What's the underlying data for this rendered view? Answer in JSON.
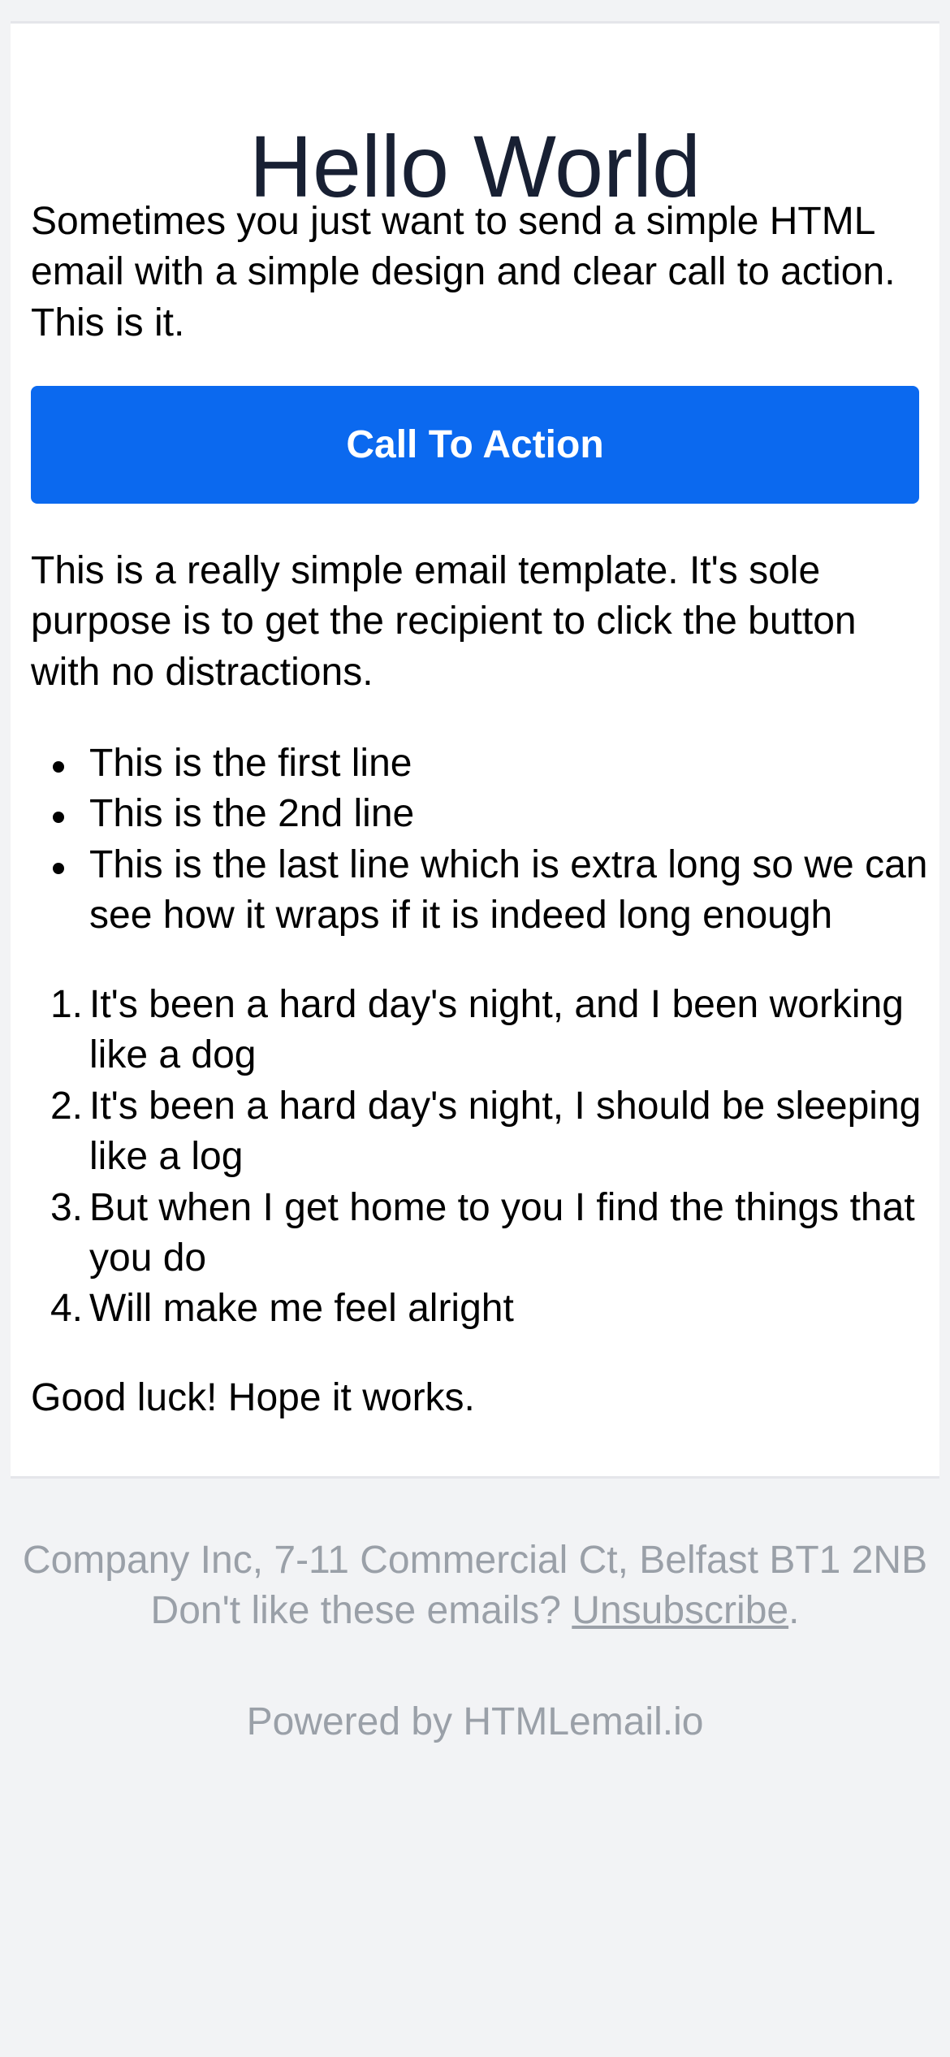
{
  "email": {
    "title": "Hello World",
    "intro": "Sometimes you just want to send a simple HTML email with a simple design and clear call to action. This is it.",
    "cta_label": "Call To Action",
    "body": "This is a really simple email template. It's sole purpose is to get the recipient to click the button with no distractions.",
    "bullets": [
      "This is the first line",
      "This is the 2nd line",
      "This is the last line which is extra long so we can see how it wraps if it is indeed long enough"
    ],
    "numbered": [
      {
        "marker": "1.",
        "text": "It's been a hard day's night, and I been working like a dog"
      },
      {
        "marker": "2.",
        "text": "It's been a hard day's night, I should be sleeping like a log"
      },
      {
        "marker": "3.",
        "text": "But when I get home to you I find the things that you do"
      },
      {
        "marker": "4.",
        "text": "Will make me feel alright"
      }
    ],
    "closing": "Good luck! Hope it works."
  },
  "footer": {
    "address": "Company Inc, 7-11 Commercial Ct, Belfast BT1 2NB",
    "unsubscribe_prefix": "Don't like these emails?",
    "unsubscribe_link": "Unsubscribe",
    "unsubscribe_suffix": ".",
    "powered_by": "Powered by HTMLemail.io"
  },
  "colors": {
    "page_background": "#f2f3f5",
    "card_background": "#ffffff",
    "button": "#0b69ef",
    "title": "#182033",
    "footer_text": "#9aa0a8"
  }
}
